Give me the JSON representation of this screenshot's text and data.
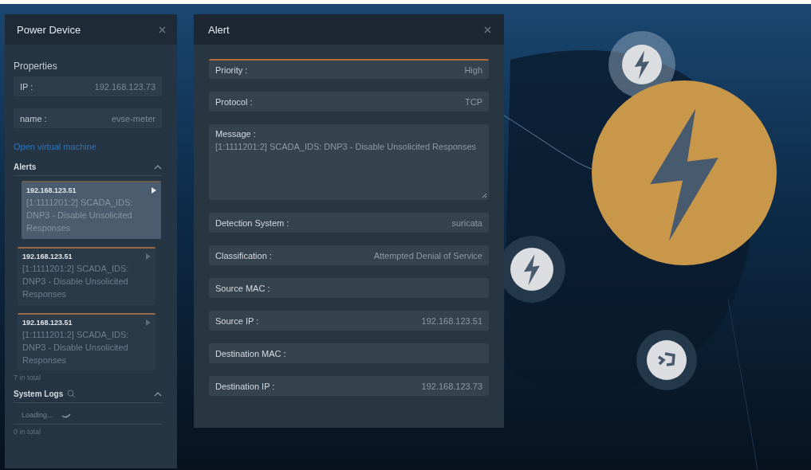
{
  "device_panel": {
    "title": "Power Device",
    "properties_label": "Properties",
    "properties": [
      {
        "label": "IP :",
        "value": "192.168.123.73"
      },
      {
        "label": "name :",
        "value": "evse-meter"
      }
    ],
    "link": "Open virtual machine",
    "alerts": {
      "title": "Alerts",
      "expanded": true,
      "items": [
        {
          "ip": "192.168.123.51",
          "message": "[1:1111201:2] SCADA_IDS: DNP3 - Disable Unsolicited Responses",
          "selected": true
        },
        {
          "ip": "192.168.123.51",
          "message": "[1:1111201:2] SCADA_IDS: DNP3 - Disable Unsolicited Responses",
          "selected": false
        },
        {
          "ip": "192.168.123.51",
          "message": "[1:1111201:2] SCADA_IDS: DNP3 - Disable Unsolicited Responses",
          "selected": false
        }
      ],
      "total": "7 in total"
    },
    "system_logs": {
      "title": "System Logs",
      "expanded": true,
      "status": "Loading...",
      "total": "0 in total"
    }
  },
  "alert_dialog": {
    "title": "Alert",
    "fields": [
      {
        "kind": "line",
        "label": "Priority :",
        "value": "High"
      },
      {
        "kind": "line",
        "label": "Protocol :",
        "value": "TCP"
      },
      {
        "kind": "text",
        "label": "Message :",
        "value": "[1:1111201:2] SCADA_IDS: DNP3 - Disable Unsolicited Responses"
      },
      {
        "kind": "line",
        "label": "Detection System :",
        "value": "suricata"
      },
      {
        "kind": "line",
        "label": "Classification :",
        "value": "Attempted Denial of Service"
      },
      {
        "kind": "line",
        "label": "Source MAC :"
      },
      {
        "kind": "line",
        "label": "Source IP :",
        "value": "192.168.123.51"
      },
      {
        "kind": "line",
        "label": "Destination MAC :"
      },
      {
        "kind": "line",
        "label": "Destination IP :",
        "value": "192.168.123.73"
      }
    ]
  },
  "nodes": [
    {
      "kind": "power",
      "selected": false
    },
    {
      "kind": "power",
      "selected": true
    },
    {
      "kind": "power",
      "selected": false
    },
    {
      "kind": "terminal",
      "selected": false
    }
  ]
}
